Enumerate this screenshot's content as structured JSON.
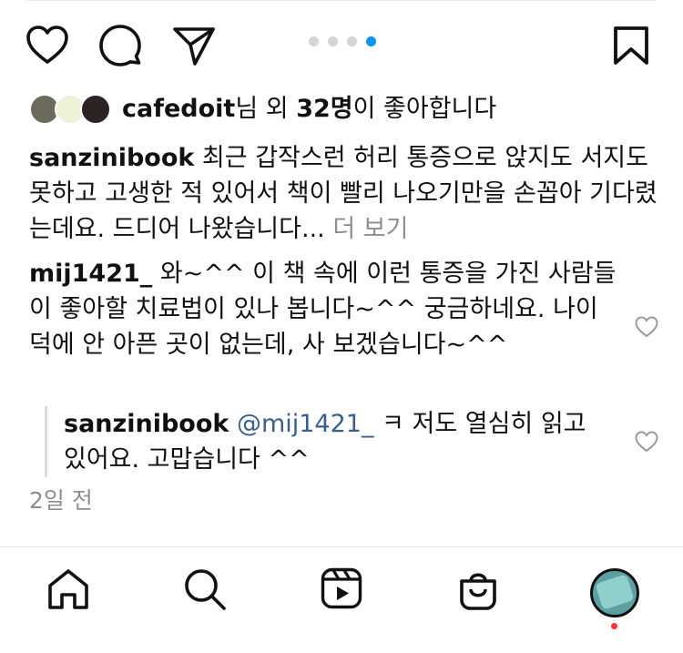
{
  "actions": {
    "like_icon": "heart-outline",
    "comment_icon": "speech-bubble",
    "share_icon": "paper-plane",
    "save_icon": "bookmark",
    "carousel": {
      "count": 4,
      "active_index": 3,
      "active_color": "#0095f6"
    }
  },
  "likes": {
    "username": "cafedoit",
    "text_after_username": "님 외 ",
    "count": "32명",
    "suffix": "이 좋아합니다"
  },
  "caption": {
    "username": "sanzinibook",
    "text": " 최근 갑작스런 허리 통증으로 앉지도 서지도 못하고 고생한 적 있어서 책이 빨리 나오기만을 손꼽아 기다렸는데요. 드디어 나왔습니다...",
    "more": " 더 보기"
  },
  "comments": [
    {
      "username": "mij1421_",
      "text": " 와~^^ 이 책 속에 이런 통증을 가진 사람들이 좋아할 치료법이 있나 봅니다~^^ 궁금하네요. 나이 덕에 안 아픈 곳이 없는데, 사 보겠습니다~^^"
    }
  ],
  "reply": {
    "username": "sanzinibook",
    "mention": "@mij1421_",
    "text": " ㅋ 저도 열심히 읽고 있어요. 고맙습니다 ^^"
  },
  "timestamp": "2일 전",
  "tabbar": {
    "items": [
      "home-icon",
      "search-icon",
      "reels-icon",
      "shop-icon",
      "profile-avatar"
    ],
    "notification_color": "#ff3040"
  }
}
